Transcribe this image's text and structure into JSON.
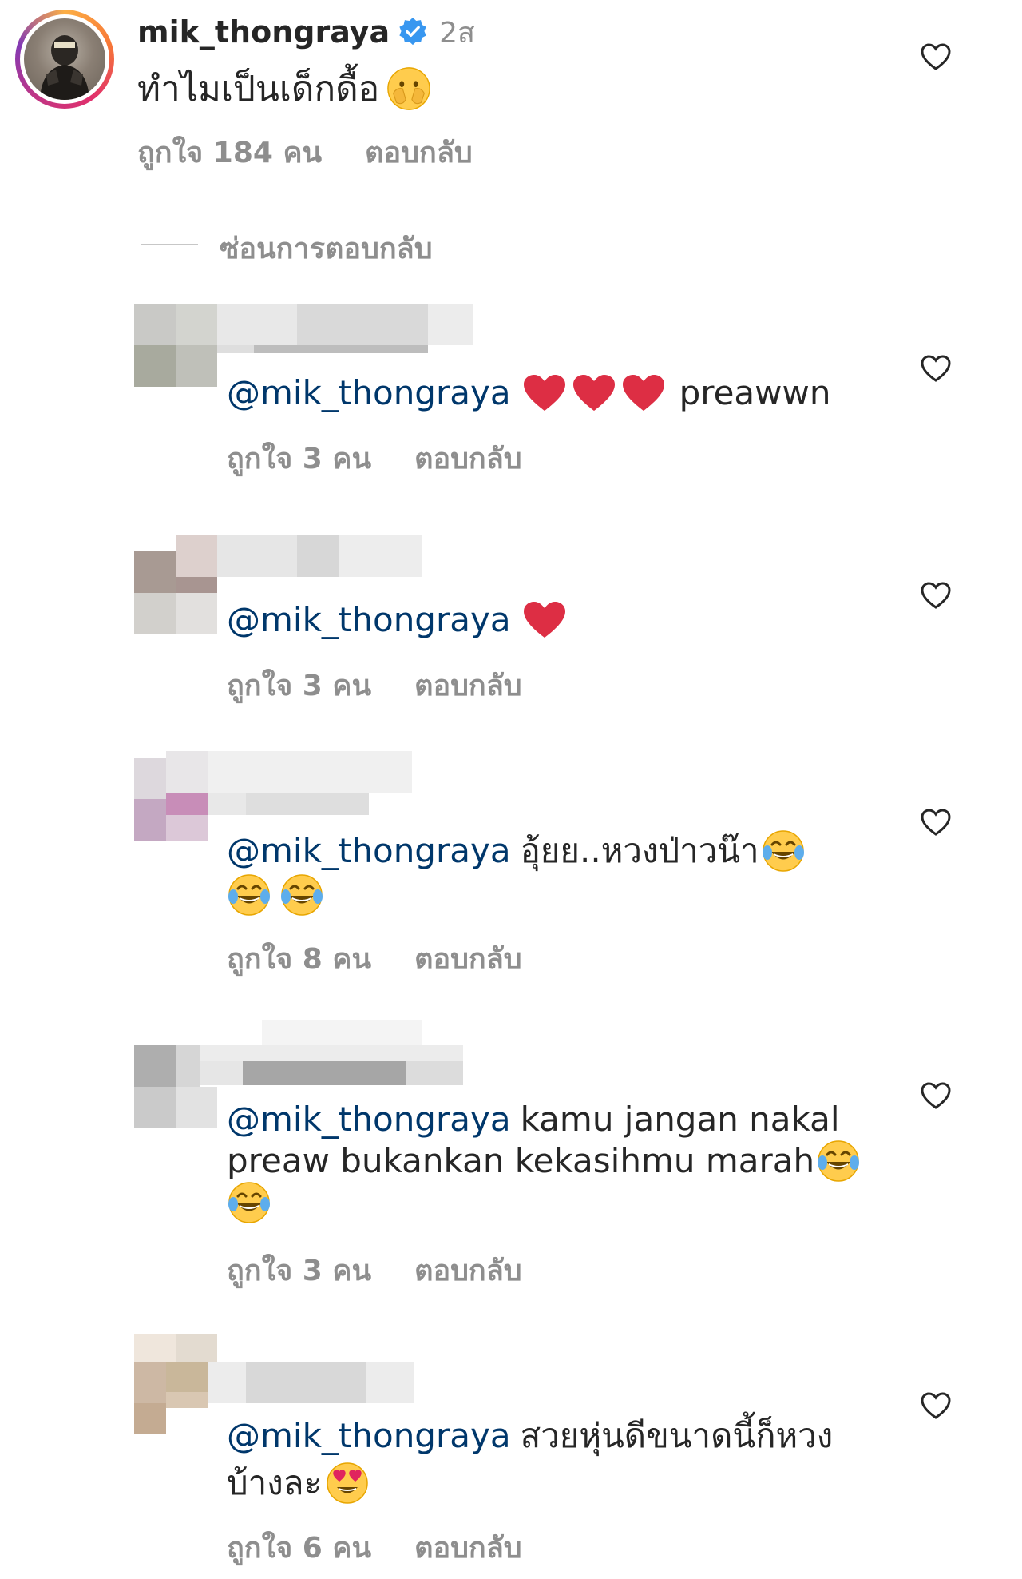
{
  "main_comment": {
    "username": "mik_thongraya",
    "time": "2ส",
    "text": "ทำไมเป็นเด็กดื้อ",
    "likes": "ถูกใจ 184 คน",
    "reply_label": "ตอบกลับ"
  },
  "hide_replies_label": "ซ่อนการตอบกลับ",
  "replies": [
    {
      "mention": "@mik_thongraya",
      "text_after": "preawwn",
      "likes": "ถูกใจ 3 คน",
      "reply_label": "ตอบกลับ"
    },
    {
      "mention": "@mik_thongraya",
      "likes": "ถูกใจ 3 คน",
      "reply_label": "ตอบกลับ"
    },
    {
      "mention": "@mik_thongraya",
      "text": "อุ้ยย..หวงป่าวน๊า",
      "likes": "ถูกใจ 8 คน",
      "reply_label": "ตอบกลับ"
    },
    {
      "mention": "@mik_thongraya",
      "text_line1": "kamu jangan nakal",
      "text_line2": "preaw bukankan kekasihmu marah",
      "likes": "ถูกใจ 3 คน",
      "reply_label": "ตอบกลับ"
    },
    {
      "mention": "@mik_thongraya",
      "text_line1": "สวยหุ่นดีขนาดนี้ก็หวง",
      "text_line2": "บ้างละ",
      "likes": "ถูกใจ 6 คน",
      "reply_label": "ตอบกลับ"
    }
  ],
  "icons": {
    "verified": "verified-badge-icon",
    "like": "heart-outline-icon",
    "emoji_heart": "red-heart-emoji",
    "emoji_laugh": "face-with-tears-of-joy-emoji",
    "emoji_cover": "face-with-hand-over-mouth-emoji",
    "emoji_love": "heart-eyes-emoji"
  },
  "colors": {
    "mention": "#00376b",
    "verified": "#3897f0",
    "meta": "#8e8e8e"
  }
}
